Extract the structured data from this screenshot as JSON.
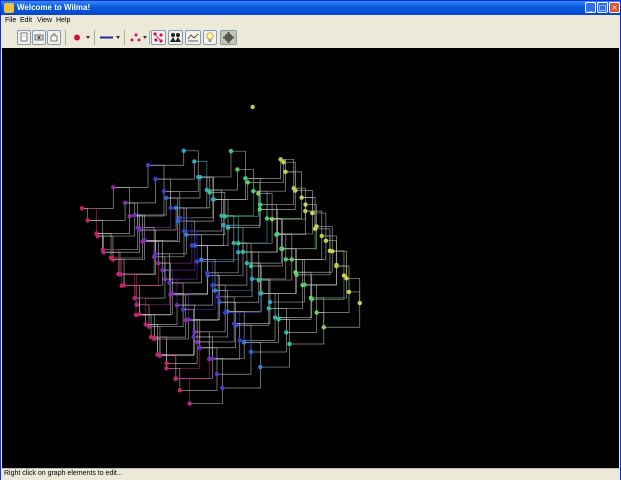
{
  "window": {
    "title": "Welcome to Wilma!",
    "controls": [
      "_",
      "□",
      "×"
    ]
  },
  "menu": {
    "items": [
      "File",
      "Edit",
      "View",
      "Help"
    ]
  },
  "toolbar": {
    "tools": [
      {
        "name": "page-tool",
        "icon": "page-icon"
      },
      {
        "name": "camera-tool",
        "icon": "camera-icon"
      },
      {
        "name": "hand-tool",
        "icon": "hand-icon"
      },
      {
        "name": "node-color-dropdown",
        "icon": "red-dot-icon",
        "color": "#d01030"
      },
      {
        "name": "edge-style-dropdown",
        "icon": "line-icon",
        "color": "#1a2a9a"
      },
      {
        "name": "layout-dropdown",
        "icon": "scatter-icon",
        "color": "#d01060"
      },
      {
        "name": "select-nodes-tool",
        "icon": "node-cluster-icon"
      },
      {
        "name": "people-tool",
        "icon": "people-icon"
      },
      {
        "name": "graph-label-tool",
        "icon": "graph-label-icon"
      },
      {
        "name": "light-tool",
        "icon": "lightbulb-icon"
      },
      {
        "name": "settings-tool",
        "icon": "gear-icon"
      }
    ]
  },
  "graph": {
    "background": "#000000",
    "edge_color": "#bbbbbb",
    "node_palette": [
      "#d0205a",
      "#b02890",
      "#6a30c8",
      "#3040d0",
      "#30a0d0",
      "#30c890",
      "#60d060",
      "#c8d050",
      "#d0d060"
    ]
  },
  "status": {
    "text": "Right click on graph elements to edit..."
  }
}
